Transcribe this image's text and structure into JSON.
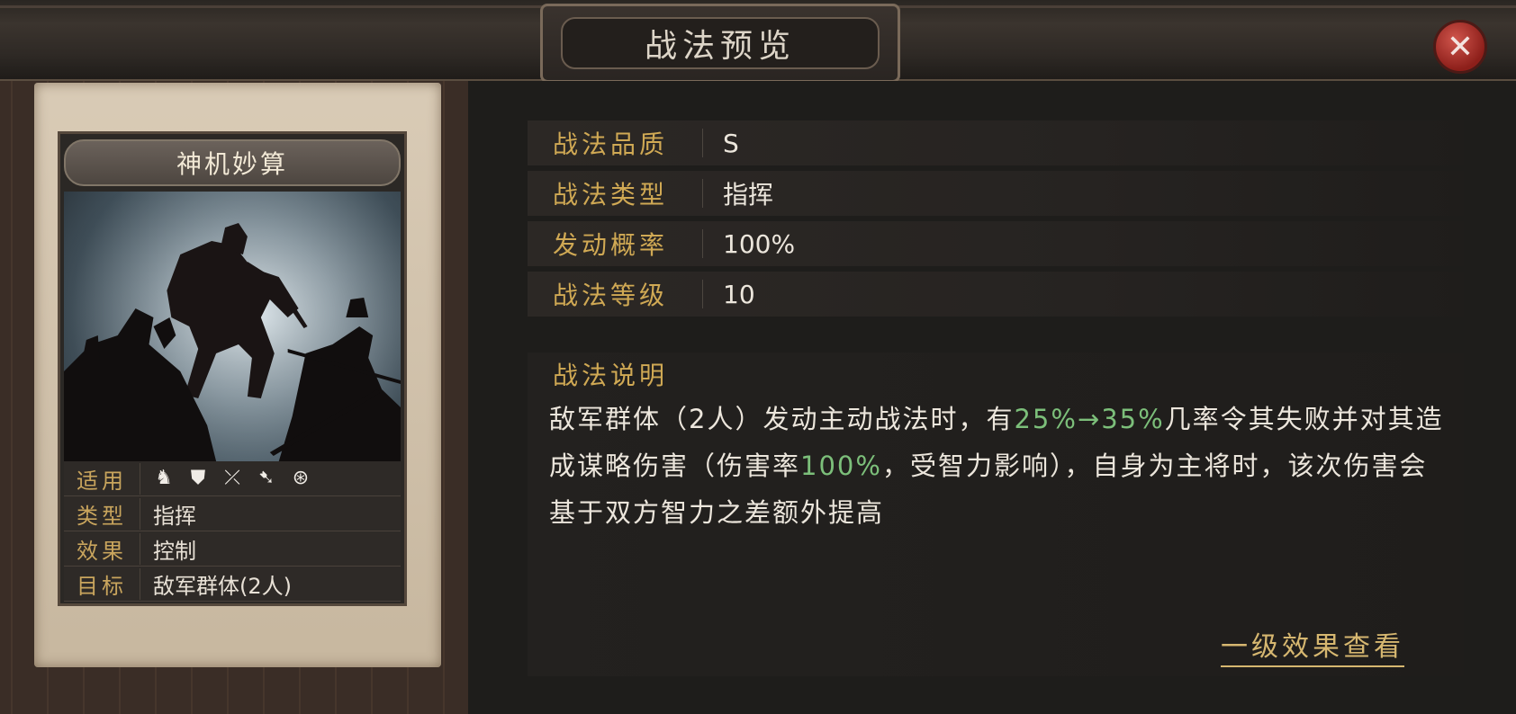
{
  "header": {
    "title": "战法预览",
    "close_symbol": "✕"
  },
  "card": {
    "name": "神机妙算",
    "rows": {
      "apply_label": "适用",
      "type_label": "类型",
      "type_value": "指挥",
      "effect_label": "效果",
      "effect_value": "控制",
      "target_label": "目标",
      "target_value": "敌军群体(2人)"
    },
    "apply_icons": [
      "cavalry-icon",
      "shield-icon",
      "bow-icon",
      "spear-icon",
      "siege-icon"
    ]
  },
  "stats": [
    {
      "label": "战法品质",
      "value": "S"
    },
    {
      "label": "战法类型",
      "value": "指挥"
    },
    {
      "label": "发动概率",
      "value": "100%"
    },
    {
      "label": "战法等级",
      "value": "10"
    }
  ],
  "description": {
    "title": "战法说明",
    "part1": "敌军群体（2人）发动主动战法时，有",
    "rate": "25%→35%",
    "part2": "几率令其失败并对其造成谋略伤害（伤害率",
    "damage_rate": "100%",
    "part3": "，受智力影响），自身为主将时，该次伤害会基于双方智力之差额外提高"
  },
  "level_one_link": "一级效果查看",
  "colors": {
    "gold": "#d0a954",
    "green": "#7cbf7a",
    "close_red": "#b9352d"
  }
}
